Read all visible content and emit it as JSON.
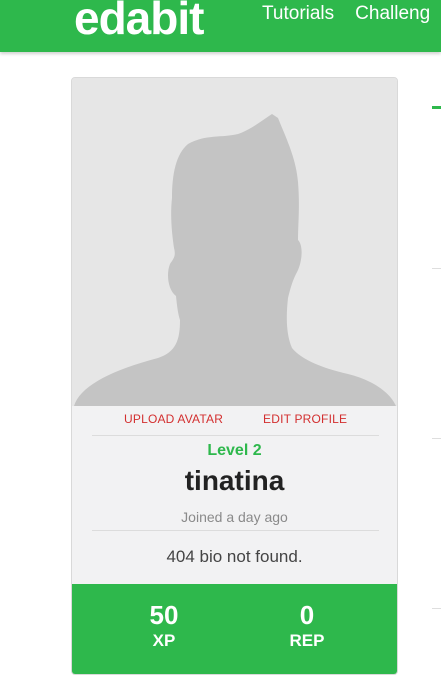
{
  "header": {
    "logo": "edabit",
    "nav": [
      "Tutorials",
      "Challeng"
    ]
  },
  "profile": {
    "actions": {
      "upload": "UPLOAD AVATAR",
      "edit": "EDIT PROFILE"
    },
    "level": "Level 2",
    "username": "tinatina",
    "joined": "Joined a day ago",
    "bio": "404 bio not found.",
    "stats": {
      "xp_value": "50",
      "xp_label": "XP",
      "rep_value": "0",
      "rep_label": "REP"
    }
  },
  "colors": {
    "brand_green": "#2eb84c",
    "action_red": "#d32f2f",
    "avatar_bg": "#e6e6e6",
    "silhouette": "#c4c4c4"
  }
}
